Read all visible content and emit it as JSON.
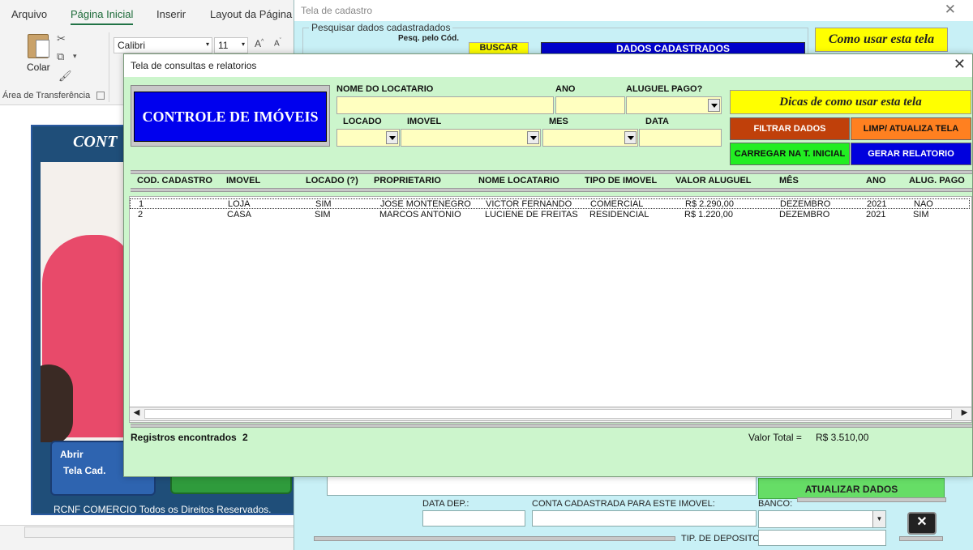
{
  "excel": {
    "tabs": [
      "Arquivo",
      "Página Inicial",
      "Inserir",
      "Layout da Página"
    ],
    "paste_label": "Colar",
    "font_name": "Calibri",
    "font_size": "11",
    "group_label": "Área de Transferência",
    "art": {
      "title": "CONT",
      "button_line1": "Abrir",
      "button_line2": "Tela Cad.",
      "footer": "RCNF COMERCIO Todos os Direitos Reservados."
    }
  },
  "cadastro": {
    "title": "Tela de cadastro",
    "search_group": "Pesquisar dados cadastradados",
    "search_by_code": "Pesq. pelo Cód.",
    "search_button": "BUSCAR",
    "registered_banner": "DADOS CADASTRADOS",
    "howto_button": "Como usar esta tela",
    "update_button": "ATUALIZAR DADOS",
    "data_dep_label": "DATA DEP.:",
    "conta_label": "CONTA CADASTRADA PARA ESTE IMOVEL:",
    "banco_label": "BANCO:",
    "tip_deposito_label": "TIP. DE DEPOSITO",
    "close_glyph": "✕"
  },
  "consultas": {
    "title": "Tela de consultas e relatorios",
    "close_glyph": "✕",
    "brand": "CONTROLE DE IMÓVEIS",
    "filters": {
      "nome_locatario": {
        "label": "NOME DO LOCATARIO",
        "value": ""
      },
      "ano": {
        "label": "ANO",
        "value": ""
      },
      "aluguel_pago": {
        "label": "ALUGUEL PAGO?",
        "value": ""
      },
      "locado": {
        "label": "LOCADO",
        "value": ""
      },
      "imovel": {
        "label": "IMOVEL",
        "value": ""
      },
      "mes": {
        "label": "MES",
        "value": ""
      },
      "data": {
        "label": "DATA",
        "value": ""
      }
    },
    "tips_button": "Dicas de como usar esta tela",
    "buttons": {
      "filtrar": "FILTRAR DADOS",
      "limpar": "LIMP/ ATUALIZA TELA",
      "carregar": "CARREGAR NA T. INICIAL",
      "gerar": "GERAR RELATORIO"
    },
    "colors": {
      "filtrar": "#c0400a",
      "limpar": "#ff8020",
      "carregar": "#22ee22",
      "gerar": "#0000dd",
      "brand": "#0000ee",
      "panel": "#ccf5cc",
      "input": "#ffffc0"
    },
    "columns": [
      "COD. CADASTRO",
      "IMOVEL",
      "LOCADO (?)",
      "PROPRIETARIO",
      "NOME LOCATARIO",
      "TIPO DE IMOVEL",
      "VALOR ALUGUEL",
      "MÊS",
      "ANO",
      "ALUG. PAGO"
    ],
    "rows": [
      [
        "1",
        "LOJA",
        "SIM",
        "JOSE MONTENEGRO",
        "VICTOR FERNANDO",
        "COMERCIAL",
        "R$ 2.290,00",
        "DEZEMBRO",
        "2021",
        "NAO"
      ],
      [
        "2",
        "CASA",
        "SIM",
        "MARCOS ANTONIO",
        "LUCIENE DE FREITAS",
        "RESIDENCIAL",
        "R$ 1.220,00",
        "DEZEMBRO",
        "2021",
        "SIM"
      ]
    ],
    "records_label": "Registros encontrados",
    "records_count": "2",
    "total_label": "Valor Total =",
    "total_value": "R$ 3.510,00"
  }
}
